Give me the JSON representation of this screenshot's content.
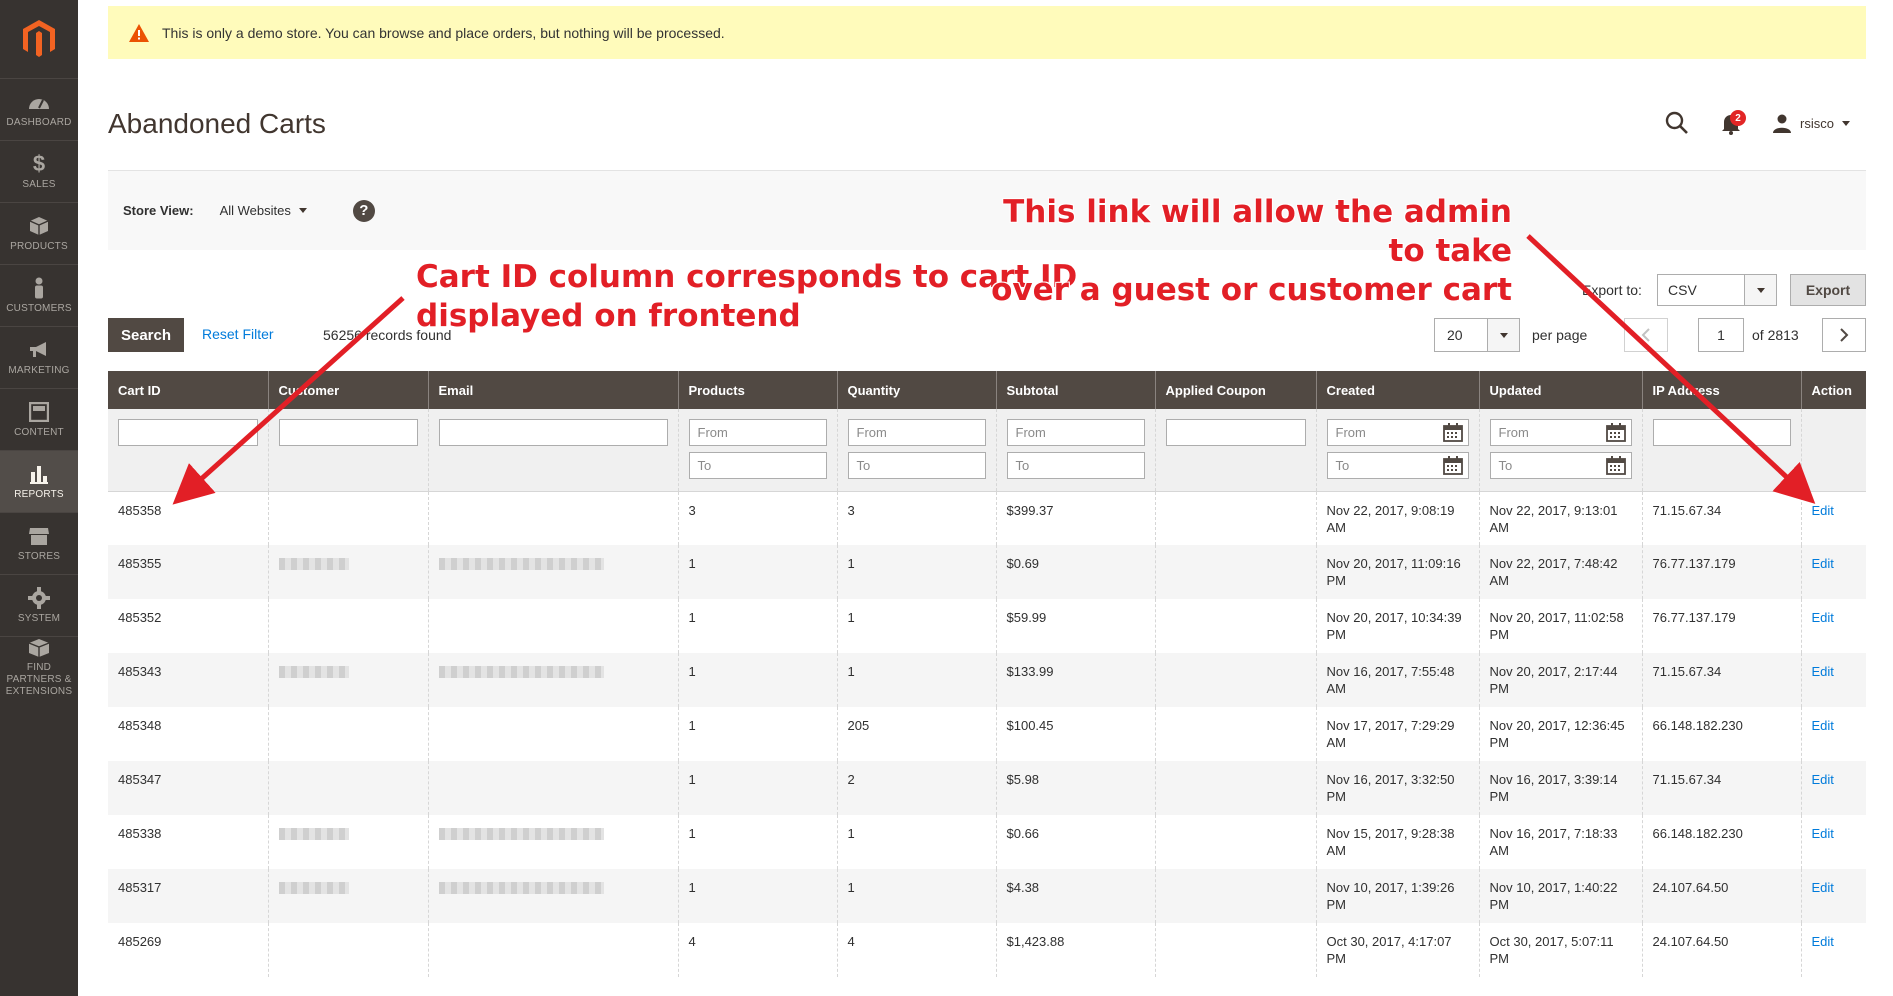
{
  "notice": {
    "text": "This is only a demo store. You can browse and place orders, but nothing will be processed."
  },
  "sidebar": {
    "items": [
      {
        "label": "DASHBOARD",
        "icon": "dashboard-icon"
      },
      {
        "label": "SALES",
        "icon": "dollar-icon"
      },
      {
        "label": "PRODUCTS",
        "icon": "box-icon"
      },
      {
        "label": "CUSTOMERS",
        "icon": "person-icon"
      },
      {
        "label": "MARKETING",
        "icon": "megaphone-icon"
      },
      {
        "label": "CONTENT",
        "icon": "layout-icon"
      },
      {
        "label": "REPORTS",
        "icon": "bar-chart-icon",
        "active": true
      },
      {
        "label": "STORES",
        "icon": "storefront-icon"
      },
      {
        "label": "SYSTEM",
        "icon": "gear-icon"
      },
      {
        "label": "FIND PARTNERS & EXTENSIONS",
        "icon": "partners-box-icon"
      }
    ]
  },
  "header": {
    "title": "Abandoned Carts",
    "user": "rsisco",
    "notifications": "2"
  },
  "store_view": {
    "label": "Store View:",
    "value": "All Websites"
  },
  "export": {
    "label": "Export to:",
    "format": "CSV",
    "button": "Export"
  },
  "toolbar": {
    "search": "Search",
    "reset": "Reset Filter",
    "records": "56256 records found",
    "per_page_value": "20",
    "per_page_label": "per page",
    "page": "1",
    "of_pages": "of 2813"
  },
  "grid": {
    "columns": [
      "Cart ID",
      "Customer",
      "Email",
      "Products",
      "Quantity",
      "Subtotal",
      "Applied Coupon",
      "Created",
      "Updated",
      "IP Address",
      "Action"
    ],
    "filters": {
      "from": "From",
      "to": "To"
    },
    "rows": [
      {
        "id": "485358",
        "customer": "",
        "email": "",
        "products": "3",
        "qty": "3",
        "subtotal": "$399.37",
        "coupon": "",
        "created": "Nov 22, 2017, 9:08:19 AM",
        "updated": "Nov 22, 2017, 9:13:01 AM",
        "ip": "71.15.67.34",
        "action": "Edit"
      },
      {
        "id": "485355",
        "customer": "blur",
        "email": "blur",
        "products": "1",
        "qty": "1",
        "subtotal": "$0.69",
        "coupon": "",
        "created": "Nov 20, 2017, 11:09:16 PM",
        "updated": "Nov 22, 2017, 7:48:42 AM",
        "ip": "76.77.137.179",
        "action": "Edit"
      },
      {
        "id": "485352",
        "customer": "",
        "email": "",
        "products": "1",
        "qty": "1",
        "subtotal": "$59.99",
        "coupon": "",
        "created": "Nov 20, 2017, 10:34:39 PM",
        "updated": "Nov 20, 2017, 11:02:58 PM",
        "ip": "76.77.137.179",
        "action": "Edit"
      },
      {
        "id": "485343",
        "customer": "blur",
        "email": "blur",
        "products": "1",
        "qty": "1",
        "subtotal": "$133.99",
        "coupon": "",
        "created": "Nov 16, 2017, 7:55:48 AM",
        "updated": "Nov 20, 2017, 2:17:44 PM",
        "ip": "71.15.67.34",
        "action": "Edit"
      },
      {
        "id": "485348",
        "customer": "",
        "email": "",
        "products": "1",
        "qty": "205",
        "subtotal": "$100.45",
        "coupon": "",
        "created": "Nov 17, 2017, 7:29:29 AM",
        "updated": "Nov 20, 2017, 12:36:45 PM",
        "ip": "66.148.182.230",
        "action": "Edit"
      },
      {
        "id": "485347",
        "customer": "",
        "email": "",
        "products": "1",
        "qty": "2",
        "subtotal": "$5.98",
        "coupon": "",
        "created": "Nov 16, 2017, 3:32:50 PM",
        "updated": "Nov 16, 2017, 3:39:14 PM",
        "ip": "71.15.67.34",
        "action": "Edit"
      },
      {
        "id": "485338",
        "customer": "blur",
        "email": "blur",
        "products": "1",
        "qty": "1",
        "subtotal": "$0.66",
        "coupon": "",
        "created": "Nov 15, 2017, 9:28:38 AM",
        "updated": "Nov 16, 2017, 7:18:33 AM",
        "ip": "66.148.182.230",
        "action": "Edit"
      },
      {
        "id": "485317",
        "customer": "blur",
        "email": "blur",
        "products": "1",
        "qty": "1",
        "subtotal": "$4.38",
        "coupon": "",
        "created": "Nov 10, 2017, 1:39:26 PM",
        "updated": "Nov 10, 2017, 1:40:22 PM",
        "ip": "24.107.64.50",
        "action": "Edit"
      },
      {
        "id": "485269",
        "customer": "",
        "email": "",
        "products": "4",
        "qty": "4",
        "subtotal": "$1,423.88",
        "coupon": "",
        "created": "Oct 30, 2017, 4:17:07 PM",
        "updated": "Oct 30, 2017, 5:07:11 PM",
        "ip": "24.107.64.50",
        "action": "Edit"
      }
    ]
  },
  "annotations": {
    "cart_id": [
      "Cart ID column corresponds to cart ID",
      "displayed on frontend"
    ],
    "edit_link": [
      "This link will allow the admin to take",
      "over a guest or customer cart"
    ]
  },
  "colors": {
    "sidebar": "#373330",
    "header_row": "#514943",
    "link": "#007bdb",
    "annotation": "#e21f26",
    "notice": "#fffbbb"
  }
}
